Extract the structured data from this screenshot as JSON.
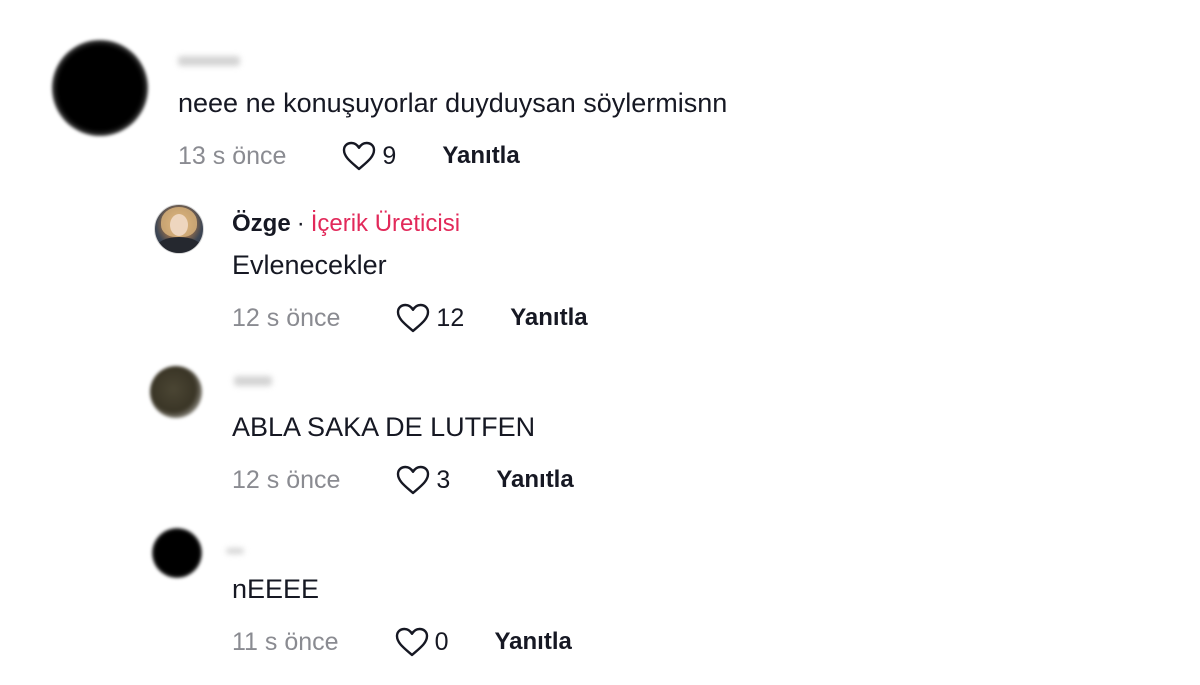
{
  "comments": [
    {
      "username": "",
      "text": "neee ne konuşuyorlar duyduysan söylermisnn",
      "time": "13 s önce",
      "likes": "9",
      "reply_label": "Yanıtla"
    },
    {
      "username": "Özge",
      "separator": "·",
      "badge": "İçerik Üreticisi",
      "text": "Evlenecekler",
      "time": "12 s önce",
      "likes": "12",
      "reply_label": "Yanıtla"
    },
    {
      "username": "",
      "text": "ABLA SAKA DE LUTFEN",
      "time": "12 s önce",
      "likes": "3",
      "reply_label": "Yanıtla"
    },
    {
      "username": "",
      "text": "nEEEE",
      "time": "11 s önce",
      "likes": "0",
      "reply_label": "Yanıtla"
    }
  ],
  "icons": {
    "like": "heart-outline-icon"
  },
  "colors": {
    "creator_badge": "#e2295a",
    "meta_text": "#8a8b91",
    "primary_text": "#161823"
  }
}
